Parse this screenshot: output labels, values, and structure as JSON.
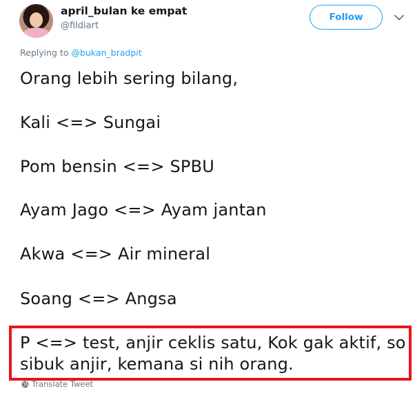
{
  "tweet": {
    "author": {
      "display_name": "april_bulan ke empat",
      "handle": "@fildiart",
      "avatar_icon": "user-avatar"
    },
    "follow_label": "Follow",
    "menu_icon": "chevron-down-icon",
    "reply": {
      "prefix": "Replying to ",
      "mention": "@bukan_bradpit"
    },
    "lines": [
      "Orang lebih sering bilang,",
      "Kali <=> Sungai",
      "Pom bensin <=> SPBU",
      "Ayam Jago <=> Ayam jantan",
      "Akwa <=> Air mineral",
      "Soang <=> Angsa"
    ],
    "highlighted_lines": [
      "P <=> test, anjir ceklis satu,  Kok gak aktif,  so",
      "sibuk anjir, kemana si nih orang."
    ],
    "translate_label": "Translate Tweet",
    "colors": {
      "accent": "#1da1f2",
      "highlight_border": "#e8141b",
      "muted": "#657786",
      "text": "#14171a"
    }
  }
}
